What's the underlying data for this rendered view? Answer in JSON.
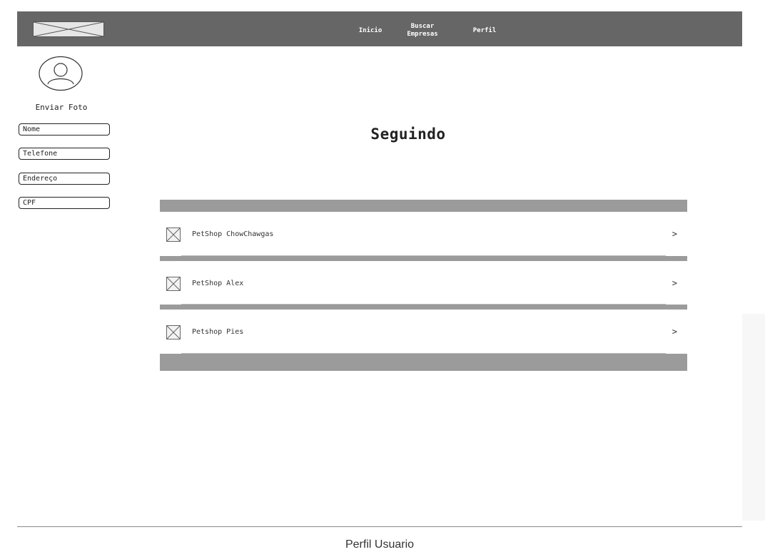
{
  "nav": {
    "items": [
      {
        "label": "Inicio"
      },
      {
        "label": "Buscar\nEmpresas"
      },
      {
        "label": "Perfil"
      }
    ]
  },
  "profile": {
    "upload_label": "Enviar Foto",
    "fields": [
      {
        "value": "Nome"
      },
      {
        "value": "Telefone"
      },
      {
        "value": "Endereço"
      },
      {
        "value": "CPF"
      }
    ]
  },
  "main": {
    "title": "Seguindo",
    "list": [
      {
        "name": "PetShop ChowChawgas",
        "chevron": ">"
      },
      {
        "name": "PetShop Alex",
        "chevron": ">"
      },
      {
        "name": "Petshop Pies",
        "chevron": ">"
      }
    ]
  },
  "footer": {
    "title": "Perfil Usuario"
  }
}
